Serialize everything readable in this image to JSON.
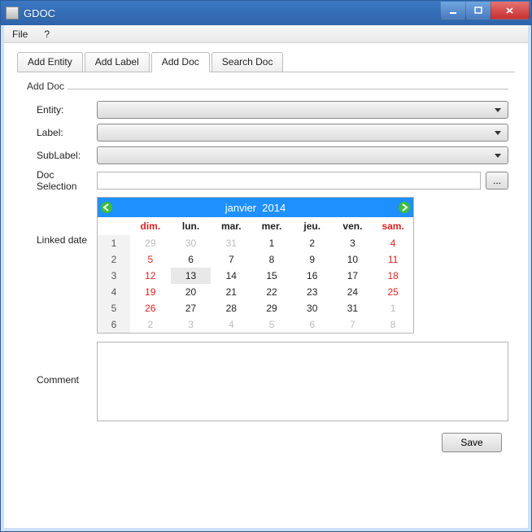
{
  "window": {
    "title": "GDOC"
  },
  "menubar": {
    "file": "File",
    "help": "?"
  },
  "tabs": {
    "add_entity": "Add Entity",
    "add_label": "Add Label",
    "add_doc": "Add Doc",
    "search_doc": "Search Doc"
  },
  "panel": {
    "title": "Add Doc",
    "entity_label": "Entity:",
    "label_label": "Label:",
    "sublabel_label": "SubLabel:",
    "docsel_label": "Doc Selection",
    "linkeddate_label": "Linked date",
    "comment_label": "Comment",
    "browse": "...",
    "save": "Save"
  },
  "calendar": {
    "month": "janvier",
    "year": "2014",
    "day_headers": [
      "dim.",
      "lun.",
      "mar.",
      "mer.",
      "jeu.",
      "ven.",
      "sam."
    ],
    "weeks": [
      {
        "wk": "1",
        "days": [
          {
            "d": "29",
            "o": true
          },
          {
            "d": "30",
            "o": true
          },
          {
            "d": "31",
            "o": true
          },
          {
            "d": "1"
          },
          {
            "d": "2"
          },
          {
            "d": "3"
          },
          {
            "d": "4",
            "w": true
          }
        ]
      },
      {
        "wk": "2",
        "days": [
          {
            "d": "5",
            "w": true
          },
          {
            "d": "6"
          },
          {
            "d": "7"
          },
          {
            "d": "8"
          },
          {
            "d": "9"
          },
          {
            "d": "10"
          },
          {
            "d": "11",
            "w": true
          }
        ]
      },
      {
        "wk": "3",
        "days": [
          {
            "d": "12",
            "w": true
          },
          {
            "d": "13",
            "t": true
          },
          {
            "d": "14"
          },
          {
            "d": "15"
          },
          {
            "d": "16"
          },
          {
            "d": "17"
          },
          {
            "d": "18",
            "w": true
          }
        ]
      },
      {
        "wk": "4",
        "days": [
          {
            "d": "19",
            "w": true
          },
          {
            "d": "20"
          },
          {
            "d": "21"
          },
          {
            "d": "22"
          },
          {
            "d": "23"
          },
          {
            "d": "24"
          },
          {
            "d": "25",
            "w": true
          }
        ]
      },
      {
        "wk": "5",
        "days": [
          {
            "d": "26",
            "w": true
          },
          {
            "d": "27"
          },
          {
            "d": "28"
          },
          {
            "d": "29"
          },
          {
            "d": "30"
          },
          {
            "d": "31"
          },
          {
            "d": "1",
            "o": true
          }
        ]
      },
      {
        "wk": "6",
        "days": [
          {
            "d": "2",
            "o": true
          },
          {
            "d": "3",
            "o": true
          },
          {
            "d": "4",
            "o": true
          },
          {
            "d": "5",
            "o": true
          },
          {
            "d": "6",
            "o": true
          },
          {
            "d": "7",
            "o": true
          },
          {
            "d": "8",
            "o": true
          }
        ]
      }
    ]
  }
}
